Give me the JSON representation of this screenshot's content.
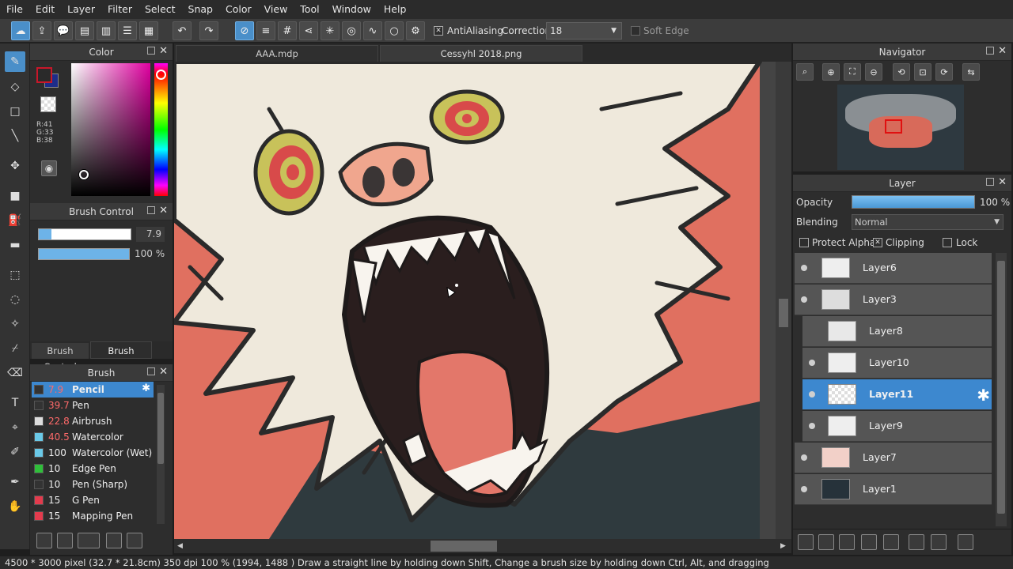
{
  "menu": [
    "File",
    "Edit",
    "Layer",
    "Filter",
    "Select",
    "Snap",
    "Color",
    "View",
    "Tool",
    "Window",
    "Help"
  ],
  "toolbar": {
    "antialiasing_label": "AntiAliasing",
    "correction_label": "Correction",
    "correction_value": "18",
    "soft_edge_label": "Soft Edge"
  },
  "color_panel": {
    "title": "Color",
    "r": "R:41",
    "g": "G:33",
    "b": "B:38",
    "primary_color": "#c8172a",
    "secondary_color": "#1d2d8a"
  },
  "brush_control": {
    "title": "Brush Control",
    "size_value": "7.9",
    "opacity_value": "100 %",
    "tabs": [
      "Brush Control",
      "Brush Preview"
    ]
  },
  "brush_panel": {
    "title": "Brush",
    "items": [
      {
        "size": "7.9",
        "name": "Pencil",
        "color": "#333333",
        "selected": true
      },
      {
        "size": "39.7",
        "name": "Pen",
        "color": "#333333"
      },
      {
        "size": "22.8",
        "name": "Airbrush",
        "color": "#dddddd"
      },
      {
        "size": "40.5",
        "name": "Watercolor",
        "color": "#6ac9e8"
      },
      {
        "size": "100",
        "name": "Watercolor (Wet)",
        "color": "#6ac9e8"
      },
      {
        "size": "10",
        "name": "Edge Pen",
        "color": "#2fbf3a"
      },
      {
        "size": "10",
        "name": "Pen (Sharp)",
        "color": "#333333"
      },
      {
        "size": "15",
        "name": "G Pen",
        "color": "#e33b4d"
      },
      {
        "size": "15",
        "name": "Mapping Pen",
        "color": "#e33b4d"
      }
    ]
  },
  "documents": {
    "tabs": [
      "AAA.mdp",
      "Cessyhl 2018.png"
    ]
  },
  "navigator": {
    "title": "Navigator"
  },
  "layer_panel": {
    "title": "Layer",
    "opacity_label": "Opacity",
    "opacity_value": "100 %",
    "opacity_level": 1.0,
    "blending_label": "Blending",
    "blending_value": "Normal",
    "protect_alpha_label": "Protect Alpha",
    "clipping_label": "Clipping",
    "lock_label": "Lock",
    "layers": [
      {
        "name": "Layer6",
        "selected": false,
        "clipped": false
      },
      {
        "name": "Layer3",
        "selected": false,
        "clipped": false
      },
      {
        "name": "Layer8",
        "selected": false,
        "clipped": true
      },
      {
        "name": "Layer10",
        "selected": false,
        "clipped": true
      },
      {
        "name": "Layer11",
        "selected": true,
        "clipped": true
      },
      {
        "name": "Layer9",
        "selected": false,
        "clipped": true
      },
      {
        "name": "Layer7",
        "selected": false,
        "clipped": false
      },
      {
        "name": "Layer1",
        "selected": false,
        "clipped": false
      }
    ]
  },
  "status": {
    "text": "4500 * 3000 pixel   (32.7 * 21.8cm)   350 dpi   100 %   (1994, 1488 )   Draw a straight line by holding down Shift, Change a brush size by holding down Ctrl, Alt, and dragging"
  }
}
